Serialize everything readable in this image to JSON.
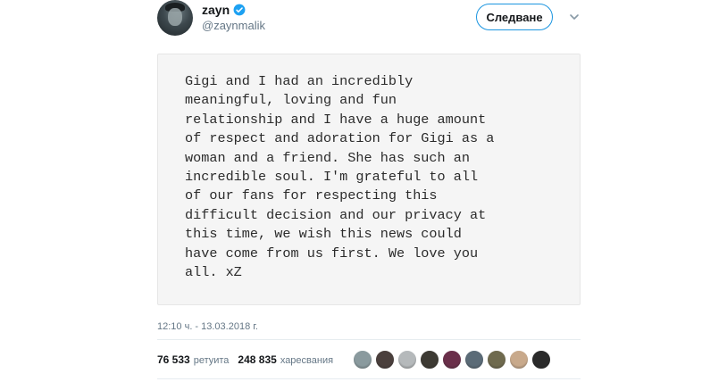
{
  "author": {
    "name": "zayn",
    "handle": "@zaynmalik",
    "verified": true
  },
  "follow_button": {
    "label": "Следване"
  },
  "tweet": {
    "text_lines": [
      "Gigi and I had an incredibly",
      "meaningful, loving and fun",
      "relationship and I have a huge amount",
      "of respect and adoration for Gigi as a",
      "woman and a friend. She has such an",
      "incredible soul. I'm grateful to all",
      "of our fans for respecting this",
      "difficult decision and our privacy at",
      "this time, we wish this news could",
      "have come from us first. We love you",
      "all. xZ"
    ],
    "timestamp": "12:10 ч. - 13.03.2018 г."
  },
  "stats": {
    "retweets_count": "76 533",
    "retweets_label": "ретуита",
    "likes_count": "248 835",
    "likes_label": "харесвания"
  },
  "likers": [
    {
      "icon": "liker-avatar-1",
      "color": "#8a9a9e"
    },
    {
      "icon": "liker-avatar-2",
      "color": "#4a3f3c"
    },
    {
      "icon": "liker-avatar-3",
      "color": "#b5b9bb"
    },
    {
      "icon": "liker-avatar-4",
      "color": "#3d3a33"
    },
    {
      "icon": "liker-avatar-5",
      "color": "#6a2f4a"
    },
    {
      "icon": "liker-avatar-6",
      "color": "#5b6b77"
    },
    {
      "icon": "liker-avatar-7",
      "color": "#6f6a4e"
    },
    {
      "icon": "liker-avatar-8",
      "color": "#c8a98b"
    },
    {
      "icon": "liker-avatar-9",
      "color": "#2a2a2a"
    }
  ],
  "colors": {
    "accent": "#1b95e0",
    "card_background": "#f5f5f5",
    "muted_text": "#657786"
  }
}
